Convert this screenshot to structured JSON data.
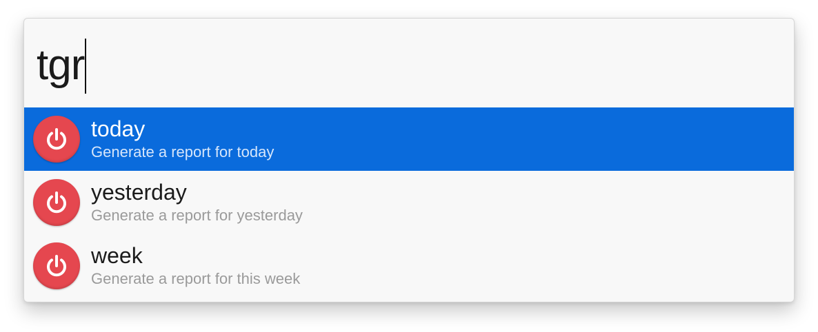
{
  "search": {
    "query": "tgr"
  },
  "results": [
    {
      "title": "today",
      "subtitle": "Generate a report for today",
      "icon": "power-icon",
      "selected": true
    },
    {
      "title": "yesterday",
      "subtitle": "Generate a report for yesterday",
      "icon": "power-icon",
      "selected": false
    },
    {
      "title": "week",
      "subtitle": "Generate a report for this week",
      "icon": "power-icon",
      "selected": false
    }
  ],
  "colors": {
    "selection": "#0a6bdc",
    "icon_background": "#e5474f"
  }
}
